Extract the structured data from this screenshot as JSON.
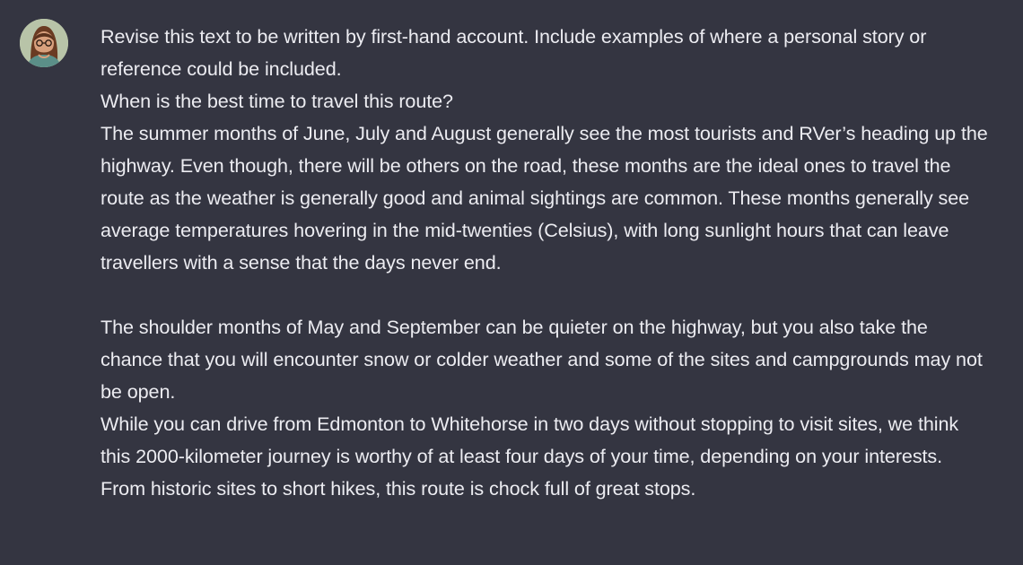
{
  "user_message": {
    "avatar_icon": "user-avatar",
    "lines": [
      "Revise this text to be written by first-hand account. Include examples of where a personal story or reference could be included.",
      "When is the best time to travel this route?",
      "The summer months of June, July and August generally see the most tourists and RVer’s heading up the highway. Even though, there will be others on the road, these months are the ideal ones to travel the route as the weather is generally good and animal sightings are common. These months generally see average temperatures hovering in the mid-twenties (Celsius), with long sunlight hours that can leave travellers with a sense that the days never end.",
      "The shoulder months of May and September can be quieter on the highway, but you also take the chance that you will encounter snow or colder weather and some of the sites and campgrounds may not be open.",
      "While you can drive from Edmonton to Whitehorse in two days without stopping to visit sites, we think this 2000-kilometer journey is worthy of at least four days of your time, depending on your interests. From historic sites to short hikes, this route is chock full of great stops."
    ]
  },
  "colors": {
    "background": "#343541",
    "text": "#ececf1"
  }
}
